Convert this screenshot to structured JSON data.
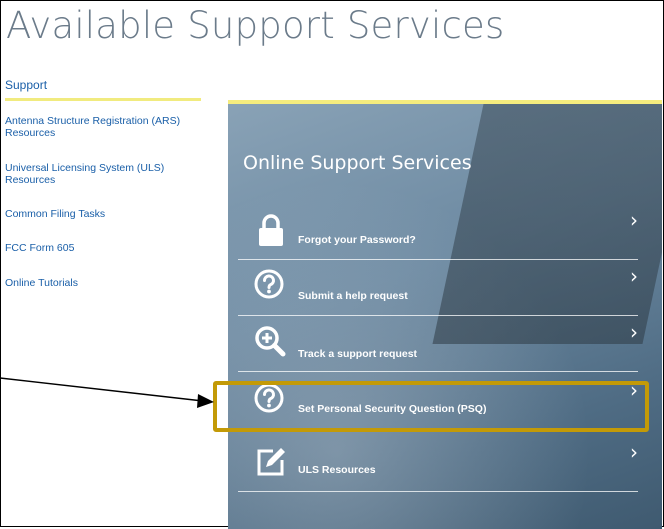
{
  "page": {
    "title": "Available Support Services"
  },
  "sidebar": {
    "heading": "Support",
    "items": [
      {
        "label": "Antenna Structure Registration (ARS) Resources"
      },
      {
        "label": "Universal Licensing System (ULS) Resources"
      },
      {
        "label": "Common Filing Tasks"
      },
      {
        "label": "FCC Form 605"
      },
      {
        "label": "Online Tutorials"
      }
    ]
  },
  "panel": {
    "title": "Online Support Services",
    "services": [
      {
        "label": "Forgot your Password?",
        "icon": "lock-icon",
        "chevron": "›"
      },
      {
        "label": "Submit a help request",
        "icon": "question-circle-icon",
        "chevron": "›"
      },
      {
        "label": "Track a support request",
        "icon": "search-plus-icon",
        "chevron": "›"
      },
      {
        "label": "Set Personal Security Question (PSQ)",
        "icon": "question-circle-icon",
        "chevron": "›"
      },
      {
        "label": "ULS Resources",
        "icon": "edit-icon",
        "chevron": "›"
      }
    ]
  },
  "annotation": {
    "highlight_color": "#c39a07",
    "highlighted_item": "Set Personal Security Question (PSQ)"
  },
  "colors": {
    "link": "#1a5fa8",
    "accent_yellow": "#f1eb7f",
    "panel_bg": "#5d7a92"
  }
}
